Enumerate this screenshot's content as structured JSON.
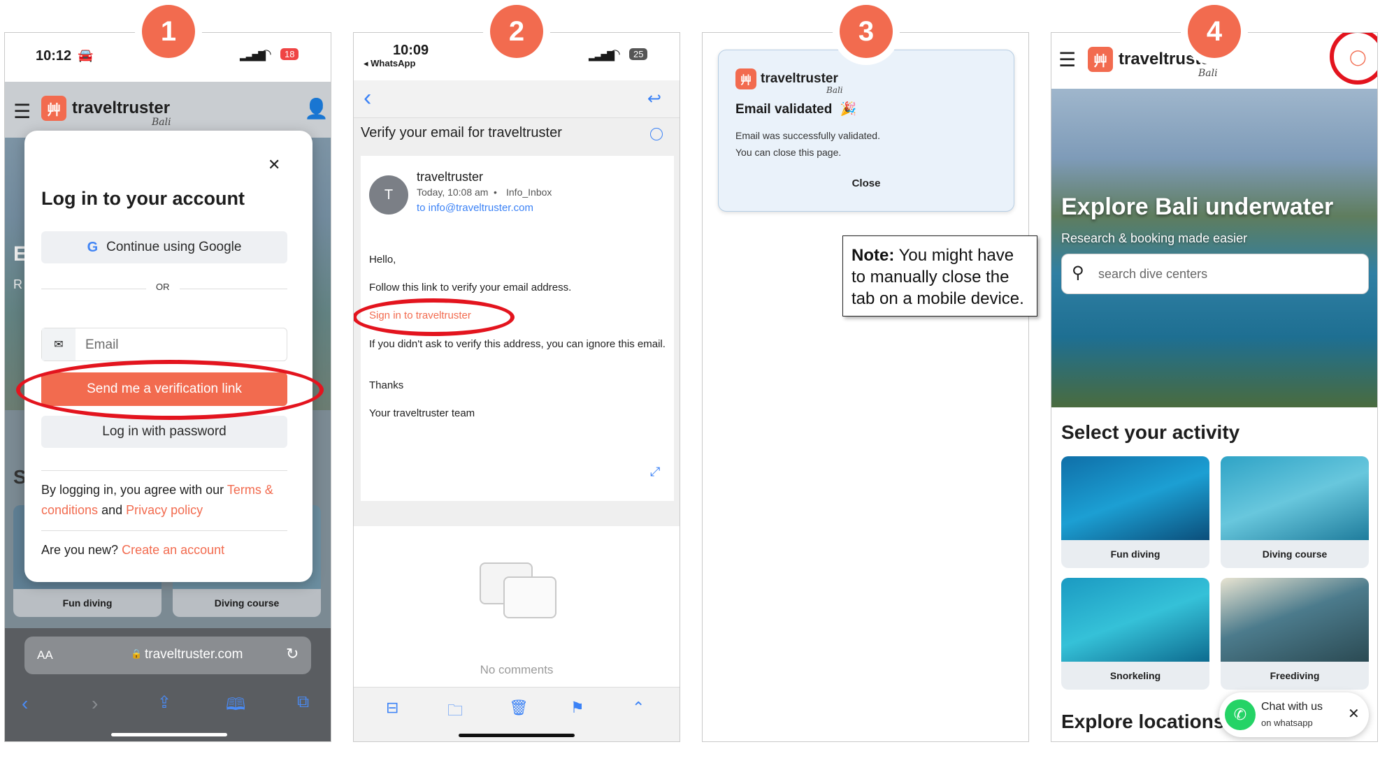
{
  "steps": [
    "1",
    "2",
    "3",
    "4"
  ],
  "colors": {
    "accent": "#f26b4f",
    "highlight": "#e3141e",
    "link_blue": "#3b82f6"
  },
  "brand": {
    "logo_mark": "⾋",
    "name": "traveltruster",
    "region": "Bali"
  },
  "panel1": {
    "time": "10:12",
    "battery": "18",
    "modal": {
      "title": "Log in to your account",
      "google_button": "Continue using Google",
      "divider": "OR",
      "email_placeholder": "Email",
      "send_link_button": "Send me a verification link",
      "password_button": "Log in with password",
      "agree_prefix": "By logging in, you agree with our ",
      "terms_link": "Terms & conditions",
      "and_text": " and ",
      "privacy_link": "Privacy policy",
      "new_text": "Are you new? ",
      "create_link": "Create an account"
    },
    "background_cards": [
      "Fun diving",
      "Diving course"
    ],
    "bg_letters": [
      "E",
      "R",
      "S"
    ],
    "browser": {
      "text_size": "AA",
      "url": "traveltruster.com"
    }
  },
  "panel2": {
    "time": "10:09",
    "back_app": "◂ WhatsApp",
    "battery": "25",
    "subject": "Verify your email for traveltruster",
    "sender_initial": "T",
    "sender": "traveltruster",
    "date": "Today, 10:08 am",
    "folder": "Info_Inbox",
    "to": "to info@traveltruster.com",
    "greeting": "Hello,",
    "line1": "Follow this link to verify your email address.",
    "link": "Sign in to traveltruster",
    "line2": "If you didn't ask to verify this address, you can ignore this email.",
    "thanks": "Thanks",
    "signature": "Your traveltruster team",
    "no_comments": "No comments"
  },
  "panel3": {
    "title": "Email validated",
    "title_emoji": "🎉",
    "line1": "Email was successfully validated.",
    "line2": "You can close this page.",
    "close_button": "Close",
    "note_bold": "Note:",
    "note_text": " You might have to manually close the tab on a mobile device."
  },
  "panel4": {
    "hero_title": "Explore Bali underwater",
    "hero_subtitle": "Research & booking made easier",
    "search_placeholder": "search dive centers",
    "section_title": "Select your activity",
    "activities": [
      "Fun diving",
      "Diving course",
      "Snorkeling",
      "Freediving"
    ],
    "explore_title": "Explore locations",
    "chat_title": "Chat with us",
    "chat_sub": "on whatsapp"
  }
}
